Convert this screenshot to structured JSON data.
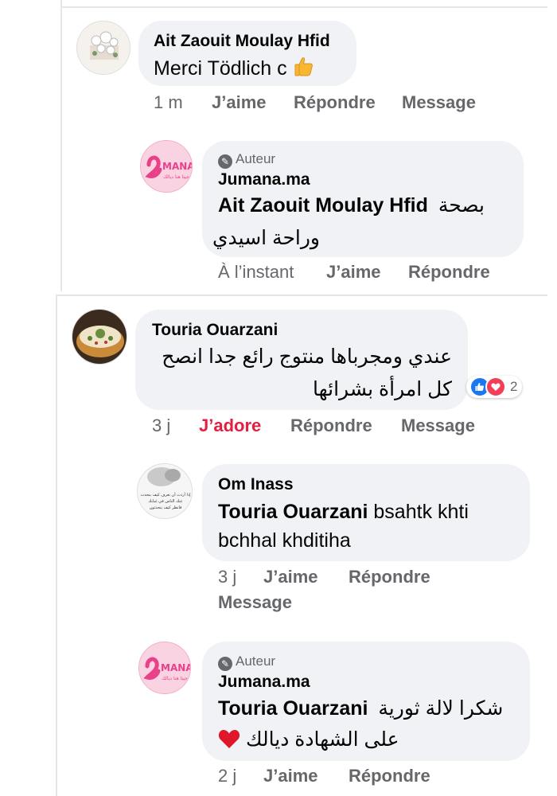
{
  "thread1": {
    "comment": {
      "author": "Ait Zaouit Moulay Hfid",
      "text": "Merci Tödlich c",
      "time": "1 m",
      "like": "J’aime",
      "reply": "Répondre",
      "message": "Message"
    },
    "reply": {
      "badge": "Auteur",
      "author": "Jumana.ma",
      "mention": "Ait Zaouit Moulay Hfid",
      "text_line1": "بصحة",
      "text_line2": "وراحة اسيدي",
      "time": "À l’instant",
      "like": "J’aime",
      "reply": "Répondre"
    }
  },
  "thread2": {
    "comment": {
      "author": "Touria Ouarzani",
      "text_line1": "عندي ومجرباها منتوج رائع جدا انصح",
      "text_line2": "كل امرأة بشرائها",
      "reaction_count": "2",
      "time": "3 j",
      "like": "J’adore",
      "reply": "Répondre",
      "message": "Message"
    },
    "reply1": {
      "author": "Om Inass",
      "mention": "Touria Ouarzani",
      "text_line1": "bsahtk khti",
      "text_line2": "bchhal khditiha",
      "time": "3 j",
      "like": "J’aime",
      "reply": "Répondre",
      "message": "Message",
      "avatar_lines": [
        "إذا أردت أن تعرف كيف يتحدث",
        "عنك الناس في غيابك",
        "فانظر كيف يتحدثون"
      ]
    },
    "reply2": {
      "badge": "Auteur",
      "author": "Jumana.ma",
      "mention": "Touria Ouarzani",
      "text_line1": "شكرا لالة ثورية",
      "text_line2": "على الشهادة ديالك",
      "time": "2 j",
      "like": "J’aime",
      "reply": "Répondre"
    }
  },
  "logo": {
    "word": "MANA",
    "tagline": "جيتا هنا ديالك",
    "color": "#e8418a"
  },
  "colors": {
    "bubble": "#f0f2f5",
    "meta": "#65676b",
    "love": "#e41e3f",
    "like_blue": "#1877f2"
  }
}
